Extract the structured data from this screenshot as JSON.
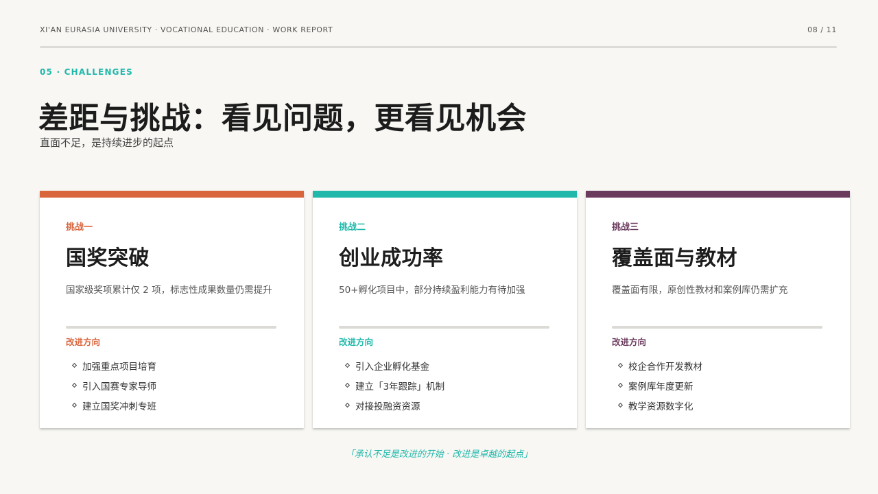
{
  "header": {
    "left": "XI'AN EURASIA UNIVERSITY · VOCATIONAL EDUCATION · WORK REPORT",
    "page": "08 / 11"
  },
  "section_tag": "05 · CHALLENGES",
  "title": "差距与挑战：看见问题，更看见机会",
  "subtitle": "直面不足，是持续进步的起点",
  "cards": [
    {
      "label": "挑战一",
      "heading": "国奖突破",
      "desc": "国家级奖项累计仅 2 项，标志性成果数量仍需提升",
      "direction_label": "改进方向",
      "items": [
        "加强重点项目培育",
        "引入国赛专家导师",
        "建立国奖冲刺专班"
      ],
      "accent": "#d9653d"
    },
    {
      "label": "挑战二",
      "heading": "创业成功率",
      "desc": "50+孵化项目中，部分持续盈利能力有待加强",
      "direction_label": "改进方向",
      "items": [
        "引入企业孵化基金",
        "建立「3年跟踪」机制",
        "对接投融资资源"
      ],
      "accent": "#1fb8ab"
    },
    {
      "label": "挑战三",
      "heading": "覆盖面与教材",
      "desc": "覆盖面有限，原创性教材和案例库仍需扩充",
      "direction_label": "改进方向",
      "items": [
        "校企合作开发教材",
        "案例库年度更新",
        "教学资源数字化"
      ],
      "accent": "#6b3b5e"
    }
  ],
  "footer_quote": "「承认不足是改进的开始 · 改进是卓越的起点」",
  "colors": {
    "background": "#f8f7f3",
    "teal": "#1fb8ab"
  }
}
